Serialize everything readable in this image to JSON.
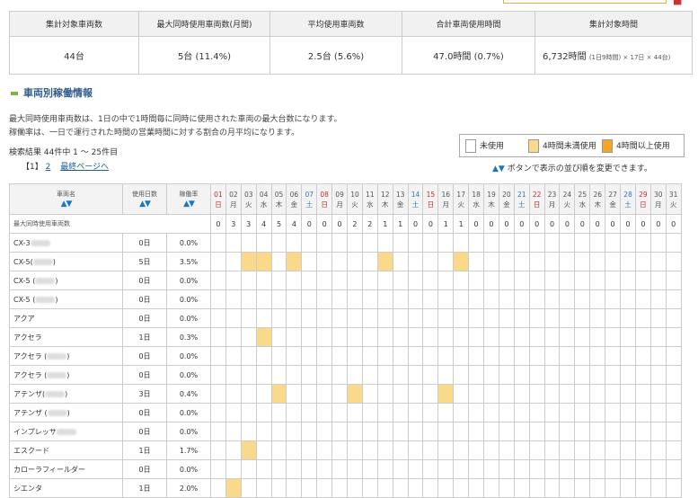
{
  "summary": {
    "headers": [
      "集計対象車両数",
      "最大同時使用車両数(月間)",
      "平均使用車両数",
      "合計車両使用時間",
      "集計対象時間"
    ],
    "values": [
      "44台",
      "5台 (11.4%)",
      "2.5台 (5.6%)",
      "47.0時間 (0.7%)",
      "6,732時間"
    ],
    "note": "(1日9時間) × 17日 × 44台)"
  },
  "section_title": "車両別稼働情報",
  "desc_lines": [
    "最大同時使用車両数は、1日の中で1時間毎に同時に使用された車両の最大台数になります。",
    "稼働率は、一日で運行された時間の営業時間に対する割合の月平均になります。"
  ],
  "result_text": "検索結果  44件中   1 ～  25件目",
  "pager": {
    "current": "【1】",
    "page2": "2",
    "last": "最終ページへ"
  },
  "legend": {
    "unused": "未使用",
    "lt4": "4時間未満使用",
    "ge4": "4時間以上使用",
    "color_lt4": "#fbd98b",
    "color_ge4": "#f6a623"
  },
  "sort_note": "ボタンで表示の並び順を変更できます。",
  "sort_arrows": "▲▼",
  "table": {
    "col_name": "車両名",
    "col_days": "使用日数",
    "col_rate": "稼働率",
    "days": [
      {
        "d": "01",
        "w": "日"
      },
      {
        "d": "02",
        "w": "月"
      },
      {
        "d": "03",
        "w": "火"
      },
      {
        "d": "04",
        "w": "水"
      },
      {
        "d": "05",
        "w": "木"
      },
      {
        "d": "06",
        "w": "金"
      },
      {
        "d": "07",
        "w": "土"
      },
      {
        "d": "08",
        "w": "日"
      },
      {
        "d": "09",
        "w": "月"
      },
      {
        "d": "10",
        "w": "火"
      },
      {
        "d": "11",
        "w": "水"
      },
      {
        "d": "12",
        "w": "木"
      },
      {
        "d": "13",
        "w": "金"
      },
      {
        "d": "14",
        "w": "土"
      },
      {
        "d": "15",
        "w": "日"
      },
      {
        "d": "16",
        "w": "月"
      },
      {
        "d": "17",
        "w": "火"
      },
      {
        "d": "18",
        "w": "水"
      },
      {
        "d": "19",
        "w": "木"
      },
      {
        "d": "20",
        "w": "金"
      },
      {
        "d": "21",
        "w": "土"
      },
      {
        "d": "22",
        "w": "日"
      },
      {
        "d": "23",
        "w": "月"
      },
      {
        "d": "24",
        "w": "火"
      },
      {
        "d": "25",
        "w": "水"
      },
      {
        "d": "26",
        "w": "木"
      },
      {
        "d": "27",
        "w": "金"
      },
      {
        "d": "28",
        "w": "土"
      },
      {
        "d": "29",
        "w": "日"
      },
      {
        "d": "30",
        "w": "月"
      },
      {
        "d": "31",
        "w": "火"
      }
    ],
    "max_row_label": "最大同時使用車両数",
    "max_values": [
      "0",
      "3",
      "3",
      "4",
      "5",
      "4",
      "0",
      "0",
      "0",
      "2",
      "2",
      "1",
      "1",
      "0",
      "0",
      "1",
      "1",
      "0",
      "0",
      "0",
      "0",
      "0",
      "0",
      "0",
      "0",
      "0",
      "0",
      "0",
      "0",
      "0",
      "0"
    ],
    "rows": [
      {
        "name": "CX-3",
        "blur": true,
        "days": "0日",
        "rate": "0.0%",
        "use": []
      },
      {
        "name": "CX-5(",
        "blur": true,
        "suffix": ")",
        "days": "5日",
        "rate": "3.5%",
        "use": [
          3,
          4,
          6,
          12,
          17
        ]
      },
      {
        "name": "CX-5 (",
        "blur": true,
        "suffix": ")",
        "days": "0日",
        "rate": "0.0%",
        "use": []
      },
      {
        "name": "CX-5 (",
        "blur": true,
        "suffix": ")",
        "days": "0日",
        "rate": "0.0%",
        "use": []
      },
      {
        "name": "アクア",
        "blur": false,
        "days": "0日",
        "rate": "0.0%",
        "use": []
      },
      {
        "name": "アクセラ",
        "blur": false,
        "days": "1日",
        "rate": "0.3%",
        "use": [
          4
        ]
      },
      {
        "name": "アクセラ (",
        "blur": true,
        "suffix": ")",
        "days": "0日",
        "rate": "0.0%",
        "use": []
      },
      {
        "name": "アクセラ (",
        "blur": true,
        "suffix": ")",
        "days": "0日",
        "rate": "0.0%",
        "use": []
      },
      {
        "name": "アテンザ(",
        "blur": true,
        "suffix": ")",
        "days": "3日",
        "rate": "0.4%",
        "use": [
          5,
          10,
          16
        ]
      },
      {
        "name": "アテンザ (",
        "blur": true,
        "suffix": ")",
        "days": "0日",
        "rate": "0.0%",
        "use": []
      },
      {
        "name": "インプレッサ",
        "blur": true,
        "days": "0日",
        "rate": "0.0%",
        "use": []
      },
      {
        "name": "エスクード",
        "blur": false,
        "days": "1日",
        "rate": "1.7%",
        "use": [
          3
        ]
      },
      {
        "name": "カローラフィールダー",
        "blur": false,
        "days": "0日",
        "rate": "0.0%",
        "use": []
      },
      {
        "name": "シエンタ",
        "blur": false,
        "days": "1日",
        "rate": "2.0%",
        "use": [
          2
        ]
      }
    ]
  }
}
